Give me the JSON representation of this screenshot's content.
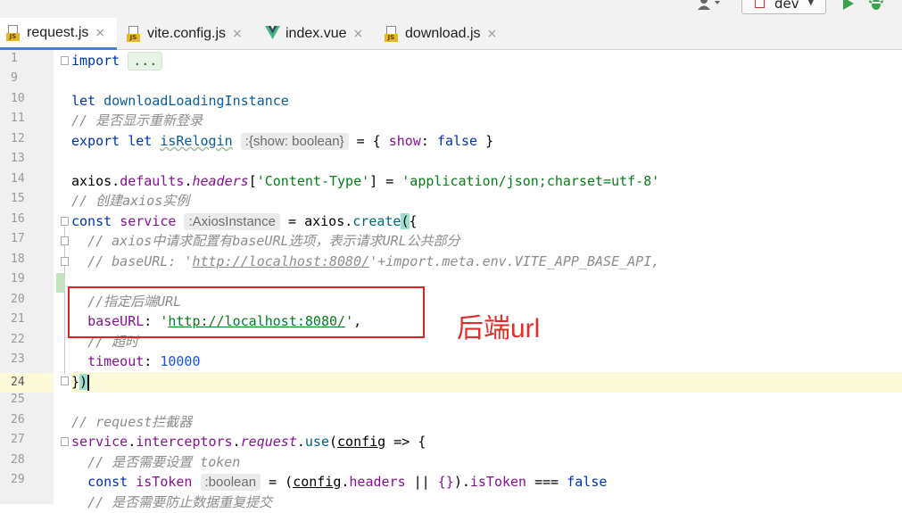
{
  "toolbar": {
    "branch": "dev",
    "branch_caret": "▼",
    "run_icon": "play-icon",
    "debug_icon": "bug-icon",
    "user_icon": "user-icon"
  },
  "tabs": [
    {
      "label": "request.js",
      "icon": "js-file-icon",
      "close": "×"
    },
    {
      "label": "vite.config.js",
      "icon": "js-file-icon",
      "close": "×"
    },
    {
      "label": "index.vue",
      "icon": "vue-file-icon",
      "close": "×"
    },
    {
      "label": "download.js",
      "icon": "js-file-icon",
      "close": "×"
    }
  ],
  "line_numbers": [
    "1",
    "9",
    "10",
    "11",
    "12",
    "13",
    "14",
    "15",
    "16",
    "17",
    "18",
    "19",
    "20",
    "21",
    "22",
    "23",
    "24",
    "25",
    "26",
    "27",
    "28",
    "29"
  ],
  "current_line": "24",
  "code": {
    "l1_kw": "import",
    "l1_fold": "...",
    "l10_kw": "let",
    "l10_name": "downloadLoadingInstance",
    "l11_comment": "// 是否显示重新登录",
    "l12_kw": "export let",
    "l12_name": "isRelogin",
    "l12_hint": ":{show: boolean}",
    "l12_rest_a": " = { ",
    "l12_key": "show",
    "l12_rest_b": ": ",
    "l12_val": "false",
    "l12_rest_c": " }",
    "l14_obj": "axios",
    "l14_dot1": ".",
    "l14_defaults": "defaults",
    "l14_dot2": ".",
    "l14_headers": "headers",
    "l14_key": "'Content-Type'",
    "l14_br1": "[",
    "l14_br2": "] = ",
    "l14_value": "'application/json;charset=utf-8'",
    "l15_comment": "// 创建axios实例",
    "l16_kw": "const",
    "l16_name": "service",
    "l16_hint": ":AxiosInstance",
    "l16_eq": " = ",
    "l16_obj": "axios",
    "l16_dot": ".",
    "l16_fn": "create",
    "l16_paren": "(",
    "l16_brace": "{",
    "l17_comment": "// axios中请求配置有baseURL选项，表示请求URL公共部分",
    "l18_comment_a": "// baseURL: '",
    "l18_link": "http://localhost:8080/",
    "l18_comment_b": "'+import.meta.env.VITE_APP_BASE_API,",
    "l20_comment": "//指定后端URL",
    "l21_key": "baseURL",
    "l21_colon": ": ",
    "l21_q1": "'",
    "l21_link": "http://localhost:8080/",
    "l21_q2": "'",
    "l21_comma": ",",
    "l22_comment": "// 超时",
    "l23_key": "timeout",
    "l23_colon": ": ",
    "l23_num": "10000",
    "l24_close": "}",
    "l24_paren": ")",
    "l26_comment": "// request拦截器",
    "l27_obj": "service",
    "l27_dot1": ".",
    "l27_interceptors": "interceptors",
    "l27_dot2": ".",
    "l27_request": "request",
    "l27_dot3": ".",
    "l27_use": "use",
    "l27_paren": "(",
    "l27_param": "config",
    "l27_arrow": " => {",
    "l28_comment": "// 是否需要设置 token",
    "l29_kw": "const",
    "l29_name": "isToken",
    "l29_hint": ":boolean",
    "l29_eq": " = (",
    "l29_param": "config",
    "l29_dot": ".",
    "l29_headers": "headers",
    "l29_or": " || ",
    "l29_empty": "{}",
    "l29_close": ").",
    "l29_prop": "isToken",
    "l29_cmp": " === ",
    "l29_val": "false",
    "l30_comment": "// 是否需要防止数据重复提交"
  },
  "annotation": {
    "text": "后端url",
    "color": "#e0302a"
  }
}
